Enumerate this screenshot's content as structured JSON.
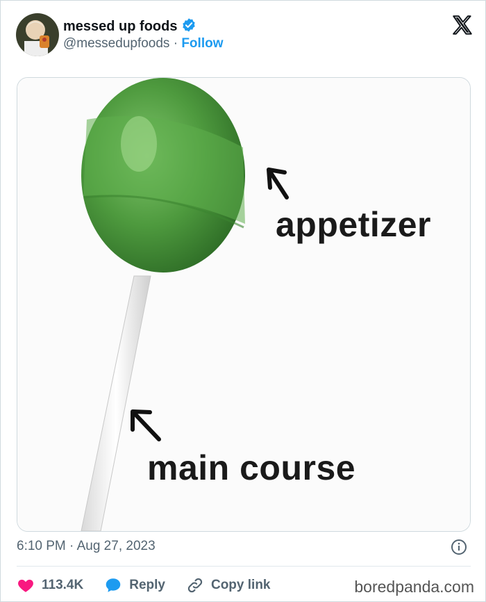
{
  "header": {
    "display_name": "messed up foods",
    "handle": "@messedupfoods",
    "separator": "·",
    "follow_label": "Follow"
  },
  "media": {
    "caption_top": "appetizer",
    "caption_bottom": "main course"
  },
  "meta": {
    "timestamp": "6:10 PM · Aug 27, 2023"
  },
  "actions": {
    "likes": "113.4K",
    "reply_label": "Reply",
    "copy_label": "Copy link"
  },
  "watermark": "boredpanda.com",
  "colors": {
    "accent": "#1d9bf0",
    "like": "#f91880",
    "muted": "#536471",
    "candy": "#4e9a3e"
  },
  "icons": [
    "verified-badge-icon",
    "x-logo-icon",
    "info-icon",
    "heart-icon",
    "reply-bubble-icon",
    "link-icon"
  ]
}
